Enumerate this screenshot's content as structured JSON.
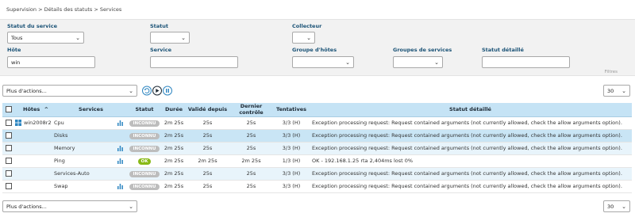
{
  "breadcrumb": [
    "Supervision",
    ">",
    "Détails des statuts",
    ">",
    "Services"
  ],
  "filters": {
    "service_status": {
      "label": "Statut du service",
      "value": "Tous"
    },
    "status": {
      "label": "Statut",
      "value": ""
    },
    "poller": {
      "label": "Collecteur",
      "value": ""
    },
    "host": {
      "label": "Hôte",
      "value": "win"
    },
    "service": {
      "label": "Service",
      "value": ""
    },
    "hostgroup": {
      "label": "Groupe d'hôtes",
      "value": ""
    },
    "servicegroup": {
      "label": "Groupes de services",
      "value": ""
    },
    "detailed_status": {
      "label": "Statut détaillé",
      "value": ""
    },
    "filters_link": "Filtres"
  },
  "toolbar": {
    "actions_placeholder": "Plus d'actions...",
    "per_page": "30"
  },
  "table": {
    "headers": [
      "Hôtes",
      "Services",
      "Statut",
      "Durée",
      "Validé depuis",
      "Dernier contrôle",
      "Tentatives",
      "Statut détaillé"
    ],
    "sort_indicator": "^",
    "rows": [
      {
        "host": "win2008r2",
        "service": "Cpu",
        "graph": true,
        "status": "INCONNU",
        "duration": "2m 25s",
        "ack": "25s",
        "last_check": "25s",
        "tries": "3/3 (H)",
        "detail": "Exception processing request: Request contained arguments (not currently allowed, check the allow arguments option)."
      },
      {
        "host": "",
        "service": "Disks",
        "graph": false,
        "status": "INCONNU",
        "duration": "2m 25s",
        "ack": "25s",
        "last_check": "25s",
        "tries": "3/3 (H)",
        "detail": "Exception processing request: Request contained arguments (not currently allowed, check the allow arguments option)."
      },
      {
        "host": "",
        "service": "Memory",
        "graph": true,
        "status": "INCONNU",
        "duration": "2m 25s",
        "ack": "25s",
        "last_check": "25s",
        "tries": "3/3 (H)",
        "detail": "Exception processing request: Request contained arguments (not currently allowed, check the allow arguments option)."
      },
      {
        "host": "",
        "service": "Ping",
        "graph": true,
        "status": "OK",
        "duration": "2m 25s",
        "ack": "2m 25s",
        "last_check": "2m 25s",
        "tries": "1/3 (H)",
        "detail": "OK - 192.168.1.25 rta 2,404ms lost 0%"
      },
      {
        "host": "",
        "service": "Services-Auto",
        "graph": false,
        "status": "INCONNU",
        "duration": "2m 25s",
        "ack": "25s",
        "last_check": "25s",
        "tries": "3/3 (H)",
        "detail": "Exception processing request: Request contained arguments (not currently allowed, check the allow arguments option)."
      },
      {
        "host": "",
        "service": "Swap",
        "graph": true,
        "status": "INCONNU",
        "duration": "2m 25s",
        "ack": "25s",
        "last_check": "25s",
        "tries": "3/3 (H)",
        "detail": "Exception processing request: Request contained arguments (not currently allowed, check the allow arguments option)."
      }
    ]
  },
  "colors": {
    "unknown": "#bdbdbd",
    "ok": "#88b917",
    "accent": "#2e86c1",
    "header_bg": "#c5e3f5"
  },
  "icons": {
    "host_os": "windows-icon",
    "graph": "graph-bars-icon",
    "refresh": "refresh-icon",
    "play": "play-icon",
    "pause": "pause-icon"
  }
}
